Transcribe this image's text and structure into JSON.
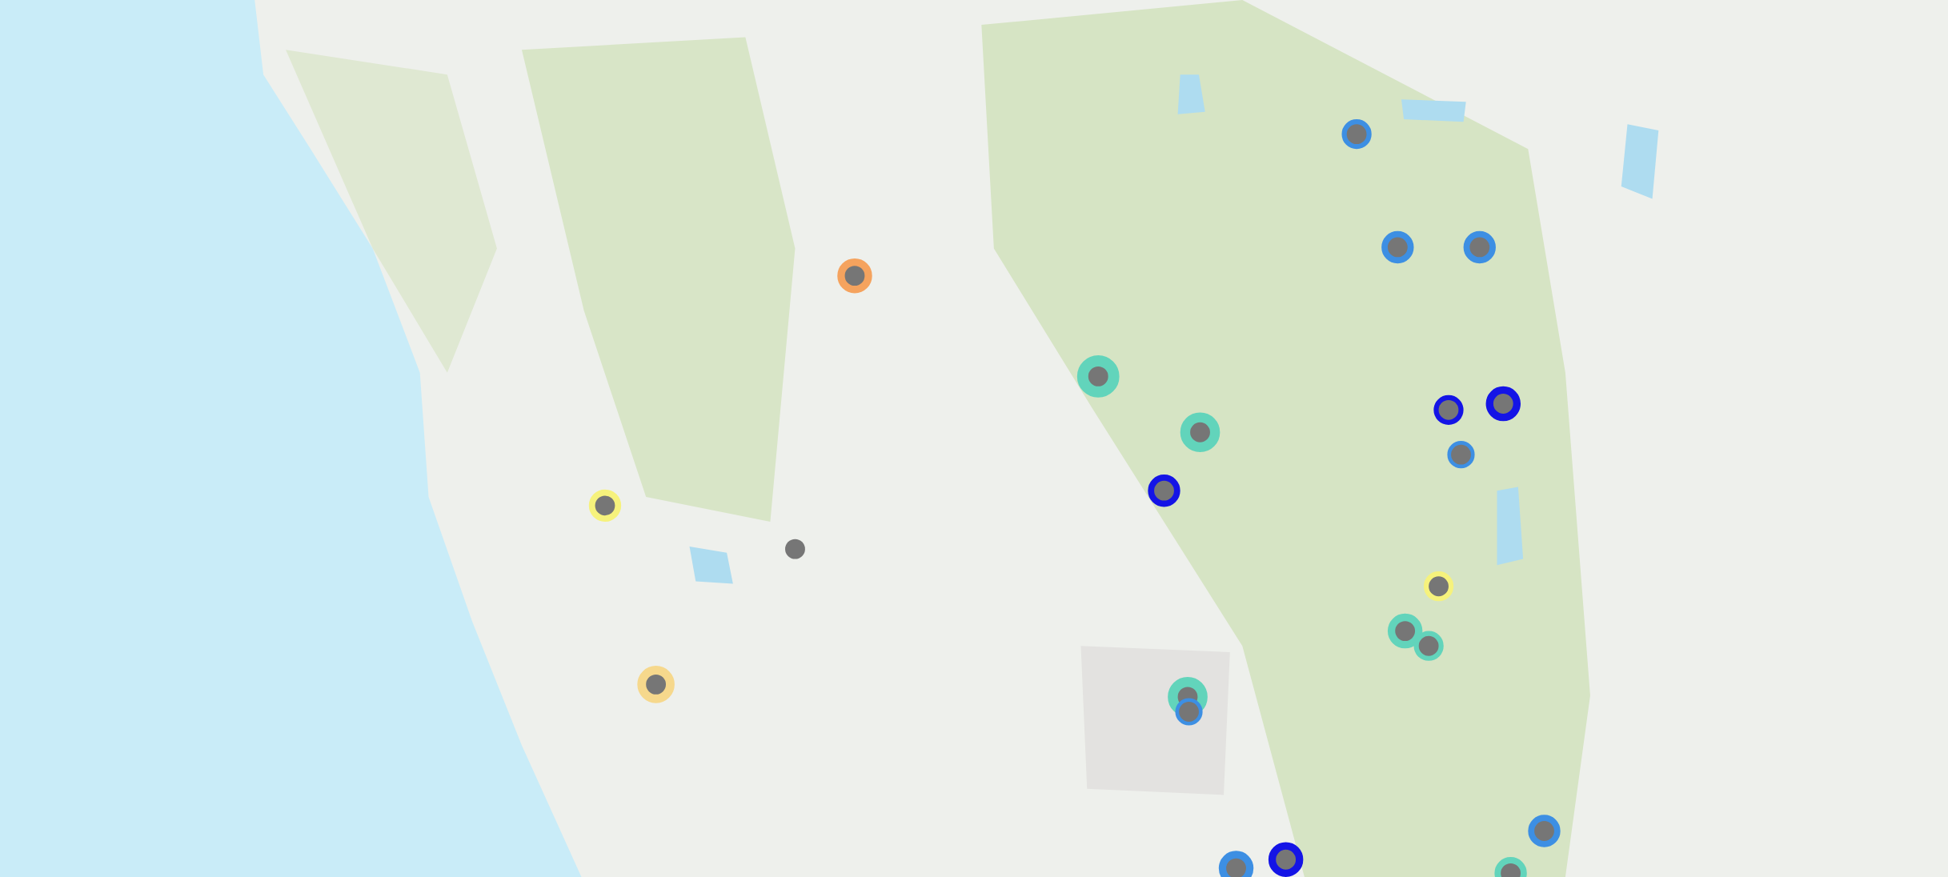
{
  "map": {
    "markers": [
      {
        "color": "#3d8fe3"
      },
      {
        "color": "#3d8fe3"
      },
      {
        "color": "#3d8fe3"
      },
      {
        "color": "#f5a35e"
      },
      {
        "color": "#62d4bb"
      },
      {
        "color": "#1414e6"
      },
      {
        "color": "#1414e6"
      },
      {
        "color": "#62d4bb"
      },
      {
        "color": "#3d8fe3"
      },
      {
        "color": "#1414e6"
      },
      {
        "color": "#f6f27c"
      },
      {
        "color": "#767676"
      },
      {
        "color": "#f6f27c"
      },
      {
        "color": "#62d4bb"
      },
      {
        "color": "#62d4bb"
      },
      {
        "color": "#f6d88c"
      },
      {
        "color": "#62d4bb"
      },
      {
        "color": "#3d8fe3"
      },
      {
        "color": "#3d8fe3"
      },
      {
        "color": "#3d8fe3"
      },
      {
        "color": "#1414e6"
      },
      {
        "color": "#62d4bb"
      }
    ]
  }
}
